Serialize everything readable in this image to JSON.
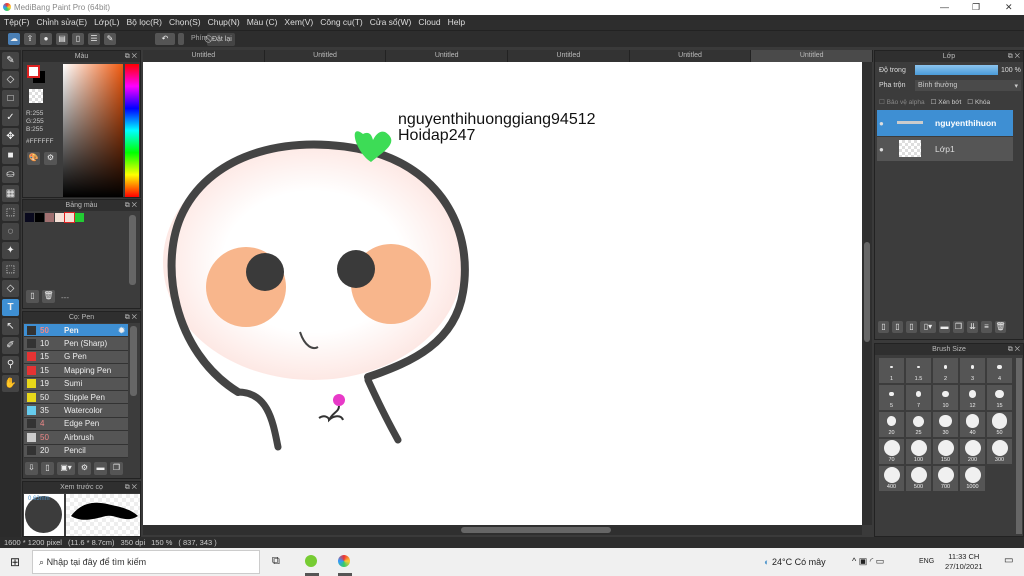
{
  "window": {
    "title": "MediBang Paint Pro (64bit)"
  },
  "menu": [
    "Tệp(F)",
    "Chỉnh sửa(E)",
    "Lớp(L)",
    "Bộ lọc(R)",
    "Chọn(S)",
    "Chụp(N)",
    "Màu (C)",
    "Xem(V)",
    "Công cụ(T)",
    "Cửa sổ(W)",
    "Cloud",
    "Help"
  ],
  "toolbar": {
    "key_label": "Phím",
    "reset_label": "Đặt lại"
  },
  "color_panel": {
    "title": "Màu",
    "r": "R:255",
    "g": "G:255",
    "b": "B:255",
    "hex": "#FFFFFF",
    "fg": "#ffffff",
    "bg": "#000000"
  },
  "palette_panel": {
    "title": "Bảng màu",
    "swatches": [
      "#0a0a1e",
      "#000000",
      "#a07070",
      "#f5e0d6",
      "#f5e0d6",
      "#22cc33"
    ],
    "footer": "---"
  },
  "brush_panel": {
    "title": "Cọ: Pen",
    "brushes": [
      {
        "size": "50",
        "name": "Pen",
        "color": "#333333"
      },
      {
        "size": "10",
        "name": "Pen (Sharp)",
        "color": "#333333"
      },
      {
        "size": "15",
        "name": "G Pen",
        "color": "#e53333"
      },
      {
        "size": "15",
        "name": "Mapping Pen",
        "color": "#e53333"
      },
      {
        "size": "19",
        "name": "Sumi",
        "color": "#e8d81a"
      },
      {
        "size": "50",
        "name": "Stipple Pen",
        "color": "#e8d81a"
      },
      {
        "size": "35",
        "name": "Watercolor",
        "color": "#66ccee"
      },
      {
        "size": "4",
        "name": "Edge Pen",
        "color": "#333333"
      },
      {
        "size": "50",
        "name": "Airbrush",
        "color": "#cccccc"
      },
      {
        "size": "20",
        "name": "Pencil",
        "color": "#333333"
      }
    ]
  },
  "preview_panel": {
    "title": "Xem trước cọ",
    "size": "0.63mm"
  },
  "tabs": [
    "Untitled",
    "Untitled",
    "Untitled",
    "Untitled",
    "Untitled",
    "Untitled"
  ],
  "canvas": {
    "text_line1": "nguyenthihuonggiang94512",
    "text_line2": "Hoidap247"
  },
  "layer_panel": {
    "title": "Lớp",
    "opacity_label": "Độ trong",
    "opacity_value": "100 %",
    "opacity": 1.0,
    "blend_label": "Pha trộn",
    "blend_value": "Bình thường",
    "protect_alpha": "Bảo vệ alpha",
    "clip": "Xén bớt",
    "lock": "Khóa",
    "layers": [
      {
        "name": "nguyenthihuon",
        "selected": true
      },
      {
        "name": "Lớp1",
        "selected": false
      }
    ]
  },
  "brush_size_panel": {
    "title": "Brush Size",
    "sizes": [
      "1",
      "1.5",
      "2",
      "3",
      "4",
      "5",
      "7",
      "10",
      "12",
      "15",
      "20",
      "25",
      "30",
      "40",
      "50",
      "70",
      "100",
      "150",
      "200",
      "300",
      "400",
      "500",
      "700",
      "1000"
    ]
  },
  "status": {
    "dims": "1600 * 1200 pixel",
    "cm": "(11.6 * 8.7cm)",
    "dpi": "350 dpi",
    "zoom": "150 %",
    "coords": "( 837, 343 )"
  },
  "taskbar": {
    "search_placeholder": "Nhập tại đây để tìm kiếm",
    "weather": "24°C Có mây",
    "lang": "ENG",
    "time": "11:33 CH",
    "date": "27/10/2021"
  }
}
